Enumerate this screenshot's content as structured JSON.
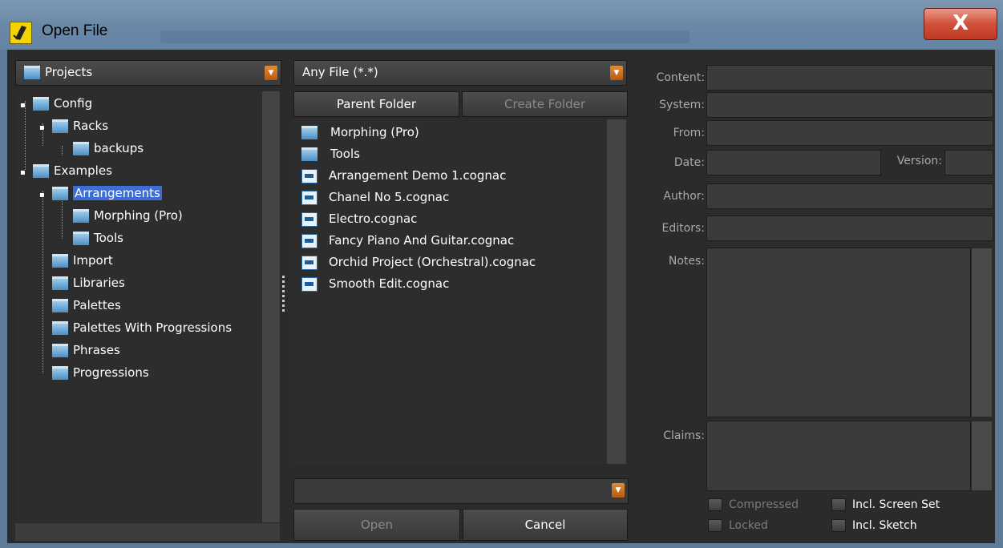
{
  "window": {
    "title": "Open File",
    "close_label": "X"
  },
  "location_dropdown": {
    "value": "Projects",
    "arrow": "▼"
  },
  "folder_tree": [
    {
      "label": "Config"
    },
    {
      "label": "Racks"
    },
    {
      "label": "backups"
    },
    {
      "label": "Examples"
    },
    {
      "label": "Arrangements"
    },
    {
      "label": "Morphing (Pro)"
    },
    {
      "label": "Tools"
    },
    {
      "label": "Import"
    },
    {
      "label": "Libraries"
    },
    {
      "label": "Palettes"
    },
    {
      "label": "Palettes With Progressions"
    },
    {
      "label": "Phrases"
    },
    {
      "label": "Progressions"
    }
  ],
  "filter_dropdown": {
    "value": "Any File (*.*)",
    "arrow": "▼"
  },
  "buttons": {
    "parent_folder": "Parent Folder",
    "create_folder": "Create Folder",
    "open": "Open",
    "cancel": "Cancel"
  },
  "files": [
    {
      "name": "Morphing (Pro)",
      "kind": "folder"
    },
    {
      "name": "Tools",
      "kind": "folder"
    },
    {
      "name": "Arrangement Demo 1.cognac",
      "kind": "file"
    },
    {
      "name": "Chanel No 5.cognac",
      "kind": "file"
    },
    {
      "name": "Electro.cognac",
      "kind": "file"
    },
    {
      "name": "Fancy Piano And Guitar.cognac",
      "kind": "file"
    },
    {
      "name": "Orchid Project (Orchestral).cognac",
      "kind": "file"
    },
    {
      "name": "Smooth Edit.cognac",
      "kind": "file"
    }
  ],
  "path_input": {
    "value": "",
    "arrow": "▼"
  },
  "info": {
    "content": "Content:",
    "system": "System:",
    "from": "From:",
    "date": "Date:",
    "version": "Version:",
    "author": "Author:",
    "editors": "Editors:",
    "notes": "Notes:",
    "claims": "Claims:"
  },
  "options": {
    "compressed": "Compressed",
    "locked": "Locked",
    "incl_screen_set": "Incl. Screen Set",
    "incl_sketch": "Incl. Sketch"
  },
  "colors": {
    "selection": "#3d6ed8",
    "accent_arrow": "#d07020",
    "close_red": "#c8442e"
  }
}
